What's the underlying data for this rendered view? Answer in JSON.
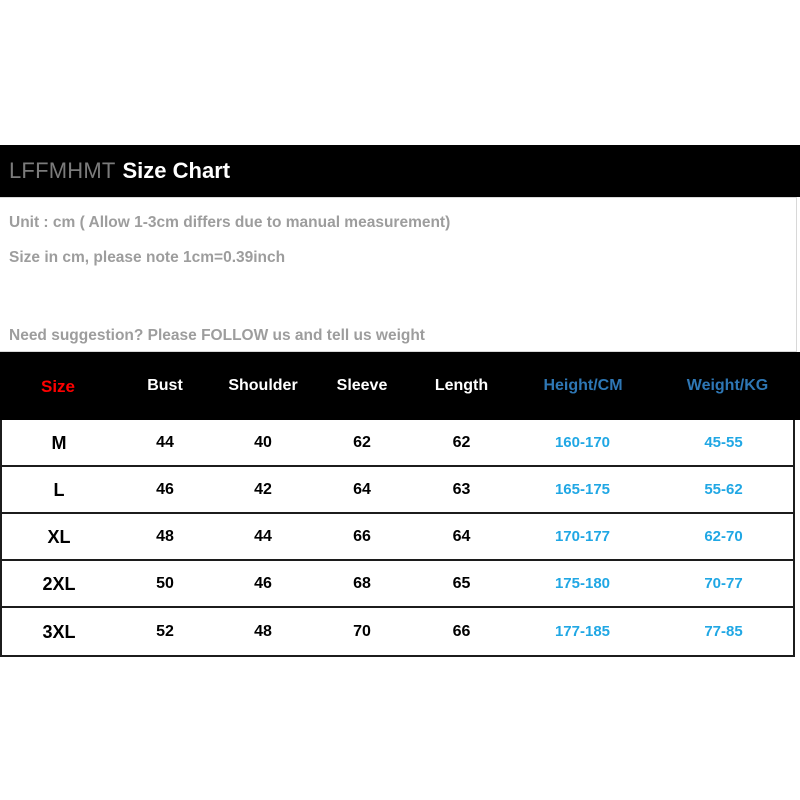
{
  "header": {
    "brand": "LFFMHMT",
    "title": "Size Chart"
  },
  "notes": {
    "line1": "Unit : cm ( Allow 1-3cm differs due to manual measurement)",
    "line2": "Size in cm, please note 1cm=0.39inch",
    "line3": "Need suggestion? Please FOLLOW us and tell us weight"
  },
  "colors": {
    "size_header": "#fe0000",
    "accent_header": "#2e77b5",
    "accent_value": "#20a7e4",
    "band_background": "#000000",
    "note_text": "#9d9d9d"
  },
  "chart_data": {
    "type": "table",
    "title": "LFFMHMT Size Chart",
    "columns": [
      "Size",
      "Bust",
      "Shoulder",
      "Sleeve",
      "Length",
      "Height/CM",
      "Weight/KG"
    ],
    "rows": [
      [
        "M",
        "44",
        "40",
        "62",
        "62",
        "160-170",
        "45-55"
      ],
      [
        "L",
        "46",
        "42",
        "64",
        "63",
        "165-175",
        "55-62"
      ],
      [
        "XL",
        "48",
        "44",
        "66",
        "64",
        "170-177",
        "62-70"
      ],
      [
        "2XL",
        "50",
        "46",
        "68",
        "65",
        "175-180",
        "70-77"
      ],
      [
        "3XL",
        "52",
        "48",
        "70",
        "66",
        "177-185",
        "77-85"
      ]
    ],
    "units": "cm",
    "notes": [
      "Unit : cm ( Allow 1-3cm differs due to manual measurement)",
      "Size in cm, please note 1cm=0.39inch",
      "Need suggestion? Please FOLLOW us and tell us weight"
    ]
  }
}
